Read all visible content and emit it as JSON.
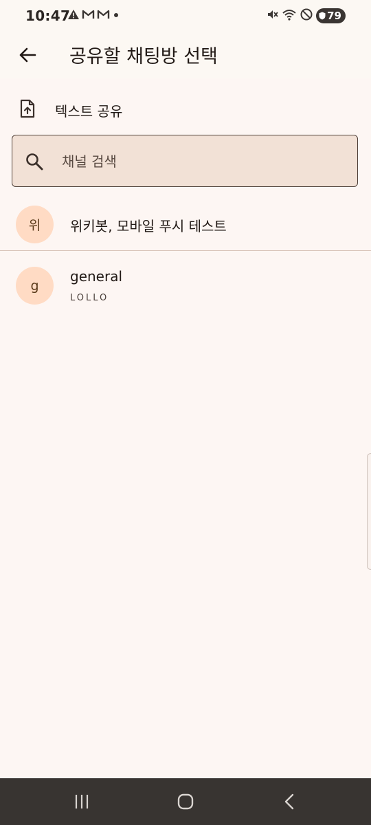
{
  "status_bar": {
    "time": "10:47",
    "battery": "79",
    "left_icons": [
      "warning-icon",
      "gmail-icon",
      "gmail-icon",
      "dot-icon"
    ],
    "right_icons": [
      "mute-icon",
      "wifi-icon",
      "dnd-icon",
      "battery-icon"
    ]
  },
  "app_bar": {
    "title": "공유할 채팅방 선택",
    "back_icon": "arrow-back-icon"
  },
  "share_text": {
    "label": "텍스트 공유",
    "icon": "file-upload-icon"
  },
  "search": {
    "placeholder": "채널 검색",
    "value": ""
  },
  "channels": [
    {
      "avatar": "위",
      "name": "위키봇, 모바일 푸시 테스트",
      "subtitle": ""
    },
    {
      "avatar": "g",
      "name": "general",
      "subtitle": "LOLLO"
    }
  ],
  "colors": {
    "background": "#fdf6f3",
    "avatar_bg": "#ffdbc4",
    "search_bg": "#f2e1d6",
    "nav_bar": "#383431"
  }
}
